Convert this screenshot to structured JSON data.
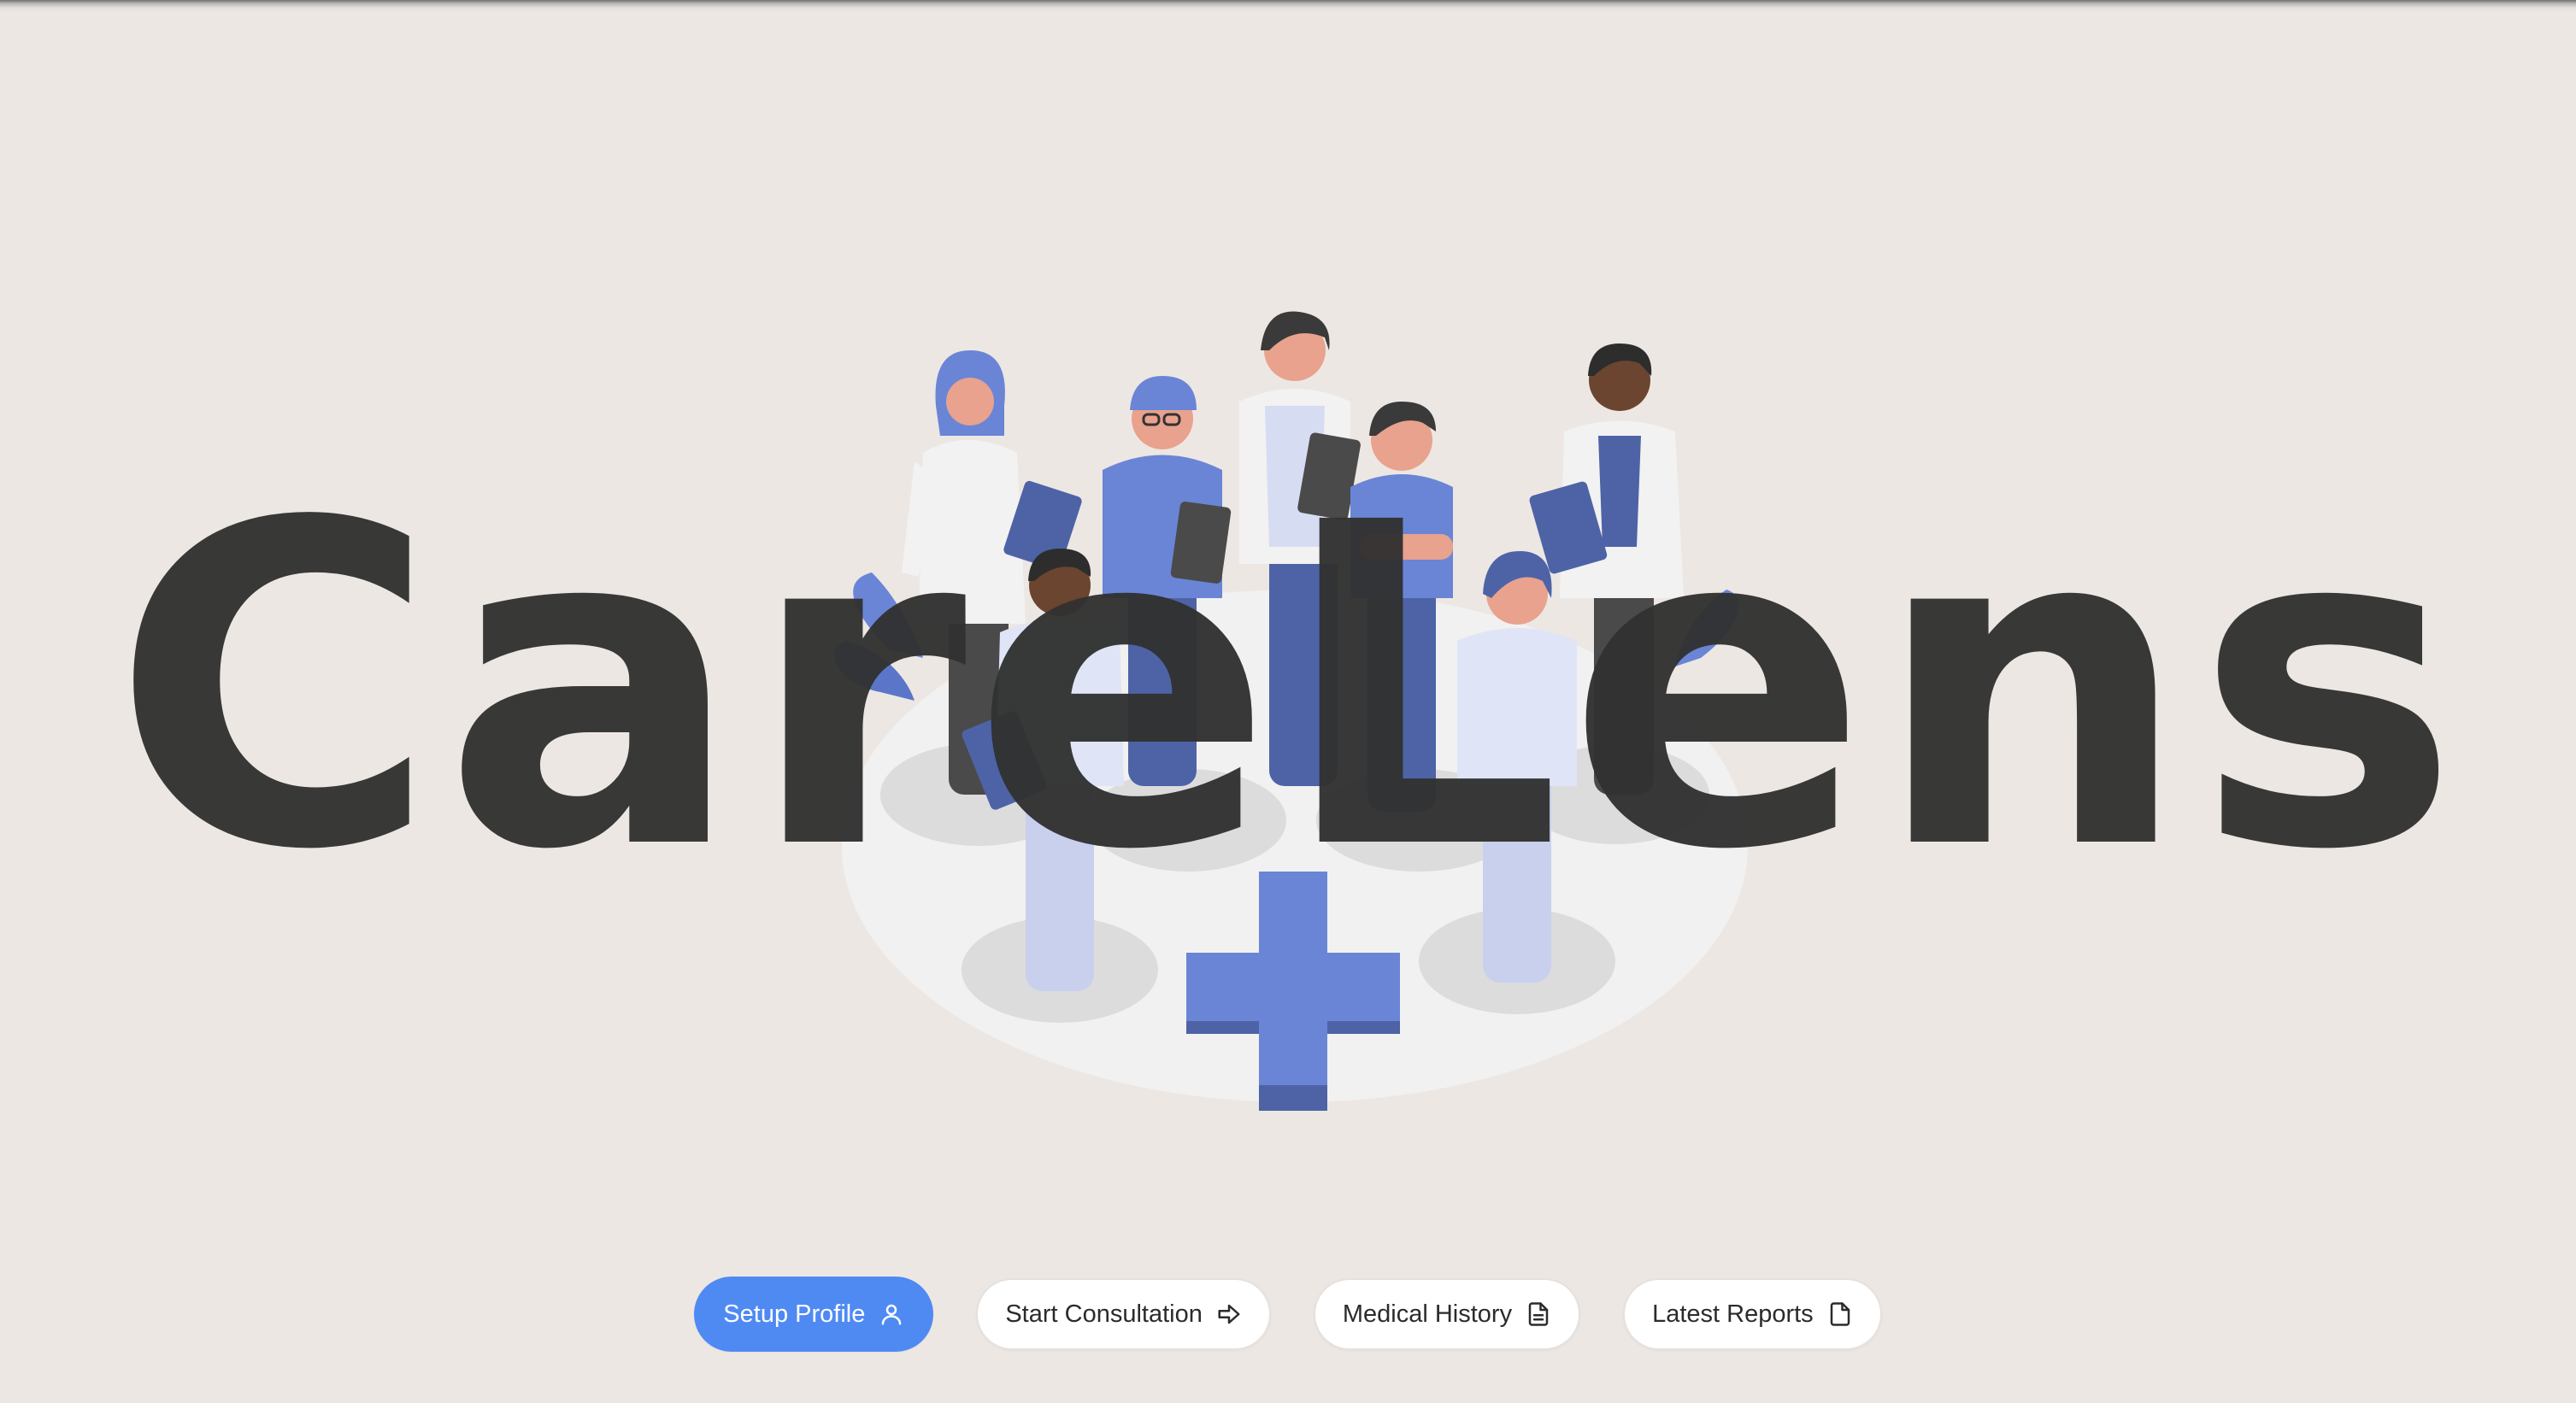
{
  "app": {
    "title": "CareLens"
  },
  "actions": [
    {
      "label": "Setup Profile",
      "icon": "user-icon",
      "primary": true
    },
    {
      "label": "Start Consultation",
      "icon": "arrow-right-icon",
      "primary": false
    },
    {
      "label": "Medical History",
      "icon": "file-text-icon",
      "primary": false
    },
    {
      "label": "Latest Reports",
      "icon": "file-icon",
      "primary": false
    }
  ],
  "colors": {
    "background": "#ede7e3",
    "primary": "#4f8af3",
    "title": "#323232",
    "illustration_accent": "#6a85d6"
  }
}
